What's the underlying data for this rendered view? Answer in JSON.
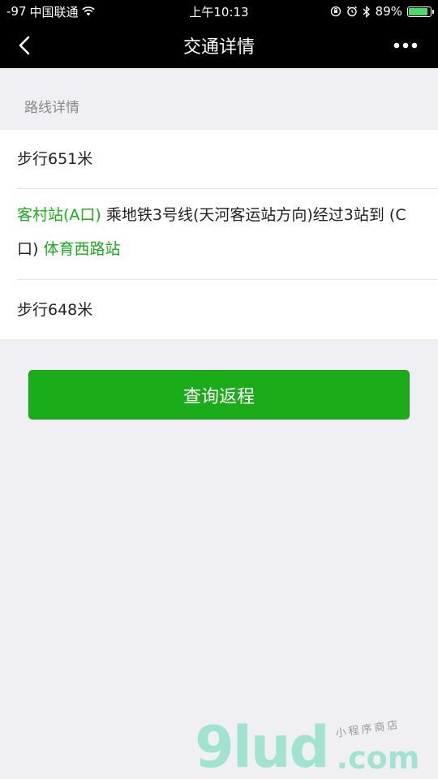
{
  "status_bar": {
    "signal": "-97",
    "carrier": "中国联通",
    "time": "上午10:13",
    "battery": "89%",
    "battery_level": 0.89
  },
  "nav": {
    "title": "交通详情",
    "more_label": "•••"
  },
  "section": {
    "label": "路线详情"
  },
  "route": {
    "step1": "步行651米",
    "from_station": "客村站(A口)",
    "transit_text": " 乘地铁3号线(天河客运站方向)经过3站到 (C口) ",
    "to_station": "体育西路站",
    "step3": "步行648米"
  },
  "actions": {
    "return_label": "查询返程"
  },
  "watermark": {
    "logo": "9lud",
    "tagline": "小程序商店",
    "domain": ".com"
  },
  "colors": {
    "accent": "#1aad19",
    "background": "#efeff4",
    "header": "#000000"
  }
}
